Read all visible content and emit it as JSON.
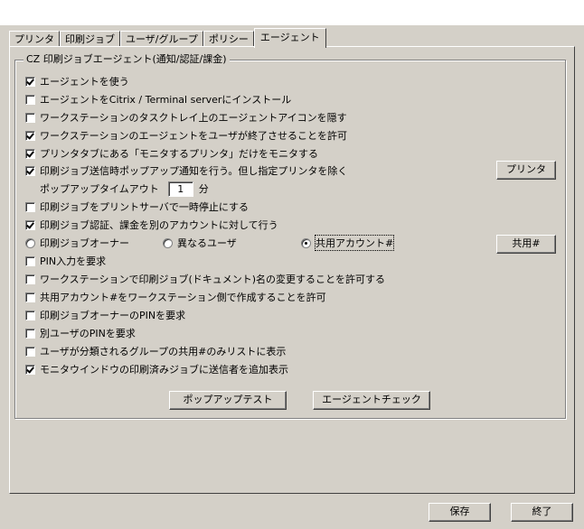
{
  "tabs": [
    {
      "label": "プリンタ",
      "active": false
    },
    {
      "label": "印刷ジョブ",
      "active": false
    },
    {
      "label": "ユーザ/グループ",
      "active": false
    },
    {
      "label": "ポリシー",
      "active": false
    },
    {
      "label": "エージェント",
      "active": true
    }
  ],
  "group_title": "CZ 印刷ジョブエージェント(通知/認証/課金)",
  "options": {
    "use_agent": {
      "label": "エージェントを使う",
      "checked": true
    },
    "install_citrix": {
      "label": "エージェントをCitrix / Terminal serverにインストール",
      "checked": false
    },
    "hide_tray_icon": {
      "label": "ワークステーションのタスクトレイ上のエージェントアイコンを隠す",
      "checked": false
    },
    "allow_user_exit": {
      "label": "ワークステーションのエージェントをユーザが終了させることを許可",
      "checked": true
    },
    "monitor_printer_tab": {
      "label": "プリンタタブにある「モニタするプリンタ」だけをモニタする",
      "checked": true
    },
    "popup_notify": {
      "label": "印刷ジョブ送信時ポップアップ通知を行う。但し指定プリンタを除く",
      "checked": true
    },
    "popup_timeout_label": "ポップアップタイムアウト",
    "popup_timeout_value": "1",
    "popup_timeout_unit": "分",
    "pause_on_server": {
      "label": "印刷ジョブをプリントサーバで一時停止にする",
      "checked": false
    },
    "auth_other_account": {
      "label": "印刷ジョブ認証、課金を別のアカウントに対して行う",
      "checked": true
    },
    "radio_owner": {
      "label": "印刷ジョブオーナー",
      "checked": false
    },
    "radio_other_user": {
      "label": "異なるユーザ",
      "checked": false
    },
    "radio_shared": {
      "label": "共用アカウント#",
      "checked": true
    },
    "require_pin": {
      "label": "PIN入力を要求",
      "checked": false
    },
    "allow_rename": {
      "label": "ワークステーションで印刷ジョブ(ドキュメント)名の変更することを許可する",
      "checked": false
    },
    "allow_create_shared": {
      "label": "共用アカウント#をワークステーション側で作成することを許可",
      "checked": false
    },
    "require_owner_pin": {
      "label": "印刷ジョブオーナーのPINを要求",
      "checked": false
    },
    "require_other_pin": {
      "label": "別ユーザのPINを要求",
      "checked": false
    },
    "group_shared_only": {
      "label": "ユーザが分類されるグループの共用#のみリストに表示",
      "checked": false
    },
    "add_sender": {
      "label": "モニタウインドウの印刷済みジョブに送信者を追加表示",
      "checked": true
    }
  },
  "buttons": {
    "printer": "プリンタ",
    "shared": "共用#",
    "popup_test": "ポップアップテスト",
    "agent_check": "エージェントチェック",
    "save": "保存",
    "exit": "終了"
  }
}
